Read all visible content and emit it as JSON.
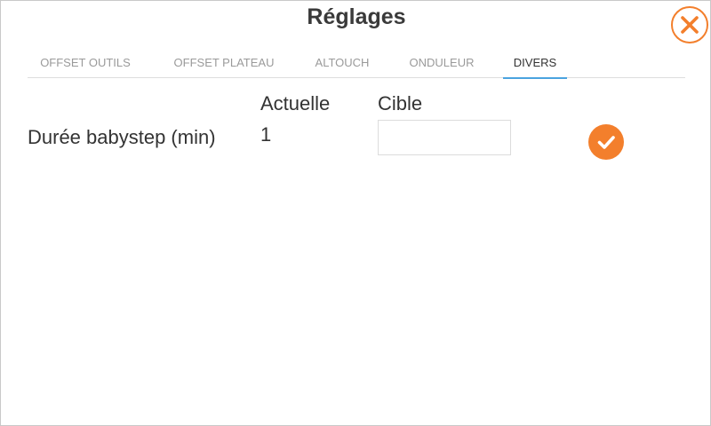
{
  "header": {
    "title": "Réglages",
    "close_icon": "close-icon"
  },
  "tabs": [
    {
      "label": "OFFSET OUTILS",
      "active": false
    },
    {
      "label": "OFFSET PLATEAU",
      "active": false
    },
    {
      "label": "ALTOUCH",
      "active": false
    },
    {
      "label": "ONDULEUR",
      "active": false
    },
    {
      "label": "DIVERS",
      "active": true
    }
  ],
  "settings": {
    "columns": {
      "current": "Actuelle",
      "target": "Cible"
    },
    "rows": [
      {
        "label": "Durée babystep (min)",
        "current_value": "1",
        "target_value": "",
        "confirm_icon": "check-icon"
      }
    ]
  },
  "colors": {
    "accent": "#f37f2c",
    "tab_underline": "#4aa3df",
    "text": "#333333",
    "tab_inactive": "#9a9a9a"
  }
}
